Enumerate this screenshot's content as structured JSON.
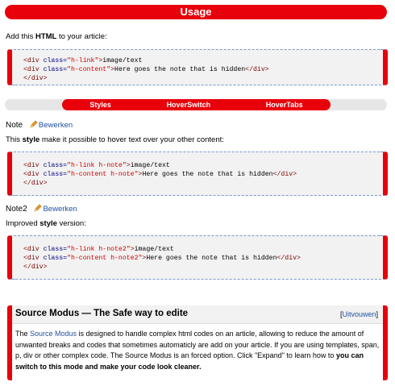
{
  "usage": {
    "title": "Usage"
  },
  "intro": {
    "pre": "Add this ",
    "bold": "HTML",
    "post": " to your article:"
  },
  "code1": {
    "line1": {
      "open": "<div ",
      "attr": "class=",
      "val": "\"h-link\"",
      "close": ">",
      "text": "image/text"
    },
    "line2": {
      "open": "<div ",
      "attr": "class=",
      "val": "\"h-content\"",
      "close": ">",
      "text": "Here goes the note that is hidden",
      "end": "</div>"
    },
    "line3": {
      "end": "</div>"
    }
  },
  "tabs": {
    "items": [
      "Styles",
      "HoverSwitch",
      "HoverTabs"
    ]
  },
  "note1": {
    "label": "Note",
    "edit": "Bewerken",
    "desc_pre": "This ",
    "desc_bold": "style",
    "desc_post": " make it possible to hover text over your other content:"
  },
  "code2": {
    "line1": {
      "open": "<div ",
      "attr": "class=",
      "val": "\"h-link h-note\"",
      "close": ">",
      "text": "image/text"
    },
    "line2": {
      "open": "<div ",
      "attr": "class=",
      "val": "\"h-content h-note\"",
      "close": ">",
      "text": "Here goes the note that is hidden",
      "end": "</div>"
    },
    "line3": {
      "end": "</div>"
    }
  },
  "note2": {
    "label": "Note2",
    "edit": "Bewerken",
    "desc_pre": "Improved ",
    "desc_bold": "style",
    "desc_post": " version:"
  },
  "code3": {
    "line1": {
      "open": "<div ",
      "attr": "class=",
      "val": "\"h-link h-note2\"",
      "close": ">",
      "text": "image/text"
    },
    "line2": {
      "open": "<div ",
      "attr": "class=",
      "val": "\"h-content h-note2\"",
      "close": ">",
      "text": "Here goes the note that is hidden",
      "end": "</div>"
    },
    "line3": {
      "end": "</div>"
    }
  },
  "source": {
    "title": "Source Modus — The Safe way to edite",
    "expand_open": "[",
    "expand": "Uitvouwen",
    "expand_close": "]",
    "body_pre": "The ",
    "body_link": "Source Modus",
    "body_mid": " is designed to handle complex html codes on an article, allowing to reduce the amount of unwanted breaks and codes that sometimes automaticly are add on your article. If you are using templates, span, p, div or other complex code. The Source Modus is an forced option. Click \"Expand\" to learn how to ",
    "body_bold": "you can switch to this mode and make your code look cleaner."
  },
  "colors": {
    "accent": "#e8000b",
    "link": "#1f4f9e",
    "code_bg": "#f2f2f2"
  },
  "icons": {
    "edit": "pencil-icon"
  }
}
